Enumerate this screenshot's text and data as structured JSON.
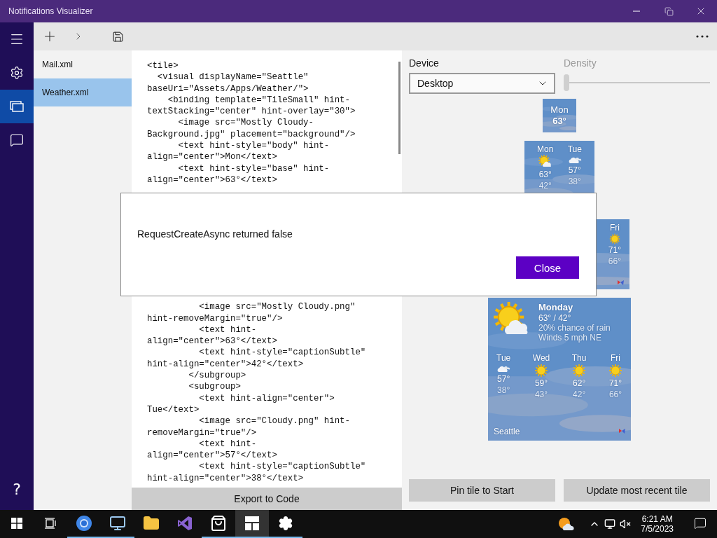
{
  "window": {
    "title": "Notifications Visualizer"
  },
  "nav_rail": {
    "items": [
      {
        "kind": "menu",
        "selected": false
      },
      {
        "kind": "settings",
        "selected": false
      },
      {
        "kind": "tiles",
        "selected": true
      },
      {
        "kind": "feedback",
        "selected": false
      }
    ],
    "help": "?"
  },
  "files": [
    {
      "name": "Mail.xml",
      "selected": false
    },
    {
      "name": "Weather.xml",
      "selected": true
    }
  ],
  "editor": {
    "lines_top": [
      "<tile>",
      "  <visual displayName=\"Seattle\"",
      "baseUri=\"Assets/Apps/Weather/\">",
      "    <binding template=\"TileSmall\" hint-",
      "textStacking=\"center\" hint-overlay=\"30\">",
      "      <image src=\"Mostly Cloudy-",
      "Background.jpg\" placement=\"background\"/>",
      "      <text hint-style=\"body\" hint-",
      "align=\"center\">Mon</text>",
      "      <text hint-style=\"base\" hint-",
      "align=\"center\">63°</text>"
    ],
    "lines_bottom": [
      "          <image src=\"Mostly Cloudy.png\"",
      "hint-removeMargin=\"true\"/>",
      "          <text hint-",
      "align=\"center\">63°</text>",
      "          <text hint-style=\"captionSubtle\"",
      "hint-align=\"center\">42°</text>",
      "        </subgroup>",
      "        <subgroup>",
      "          <text hint-align=\"center\">",
      "Tue</text>",
      "          <image src=\"Cloudy.png\" hint-",
      "removeMargin=\"true\"/>",
      "          <text hint-",
      "align=\"center\">57°</text>",
      "          <text hint-style=\"captionSubtle\"",
      "hint-align=\"center\">38°</text>"
    ],
    "export_button": "Export to Code"
  },
  "device": {
    "label": "Device",
    "value": "Desktop"
  },
  "density": {
    "label": "Density",
    "disabled": true,
    "level": 0
  },
  "tiles": {
    "small": {
      "day": "Mon",
      "temp": "63°"
    },
    "medium": {
      "days": [
        {
          "day": "Mon",
          "kind": "partly",
          "high": "63°",
          "low": "42°"
        },
        {
          "day": "Tue",
          "kind": "cloudy",
          "high": "57°",
          "low": "38°"
        }
      ]
    },
    "wide": {
      "days": [
        {
          "day": "Fri",
          "kind": "sun",
          "high": "71°",
          "low": "66°"
        }
      ]
    },
    "large": {
      "kind": "partly",
      "title": "Monday",
      "temps": "63° / 42°",
      "lines": [
        "20% chance of rain",
        "Winds 5 mph NE"
      ],
      "name": "Seattle",
      "days": [
        {
          "day": "Tue",
          "kind": "cloudy",
          "high": "57°",
          "low": "38°"
        },
        {
          "day": "Wed",
          "kind": "sun",
          "high": "59°",
          "low": "43°"
        },
        {
          "day": "Thu",
          "kind": "sun",
          "high": "62°",
          "low": "42°"
        },
        {
          "day": "Fri",
          "kind": "sun",
          "high": "71°",
          "low": "66°"
        }
      ]
    }
  },
  "buttons": [
    "Pin tile to Start",
    "Update most recent tile"
  ],
  "dialog": {
    "message": "RequestCreateAsync returned false",
    "button": "Close"
  },
  "taskbar": {
    "apps": [
      {
        "kind": "taskview",
        "selected": false,
        "running": false
      },
      {
        "kind": "browser",
        "selected": false,
        "running": true
      },
      {
        "kind": "remote",
        "selected": false,
        "running": true
      },
      {
        "kind": "folder",
        "selected": false,
        "running": false
      },
      {
        "kind": "studio",
        "selected": false,
        "running": false
      },
      {
        "kind": "store",
        "selected": false,
        "running": true
      },
      {
        "kind": "tiles",
        "selected": true,
        "running": true
      },
      {
        "kind": "settings",
        "selected": false,
        "running": true
      }
    ],
    "time": "6:21 AM",
    "date": "7/5/2023"
  }
}
